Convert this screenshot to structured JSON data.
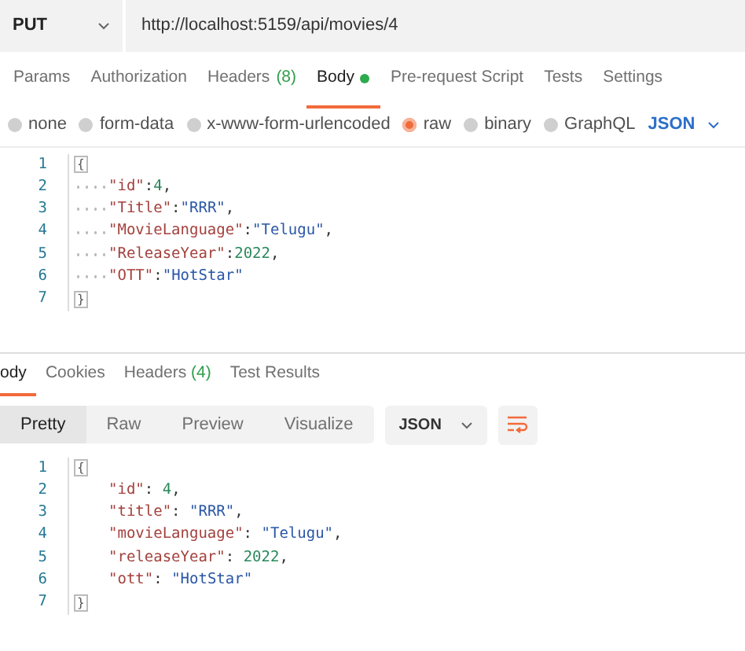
{
  "request": {
    "method": "PUT",
    "url": "http://localhost:5159/api/movies/4",
    "tabs": [
      {
        "label": "Params",
        "selected": false
      },
      {
        "label": "Authorization",
        "selected": false
      },
      {
        "label": "Headers",
        "count": "(8)",
        "selected": false
      },
      {
        "label": "Body",
        "has_content": true,
        "selected": true
      },
      {
        "label": "Pre-request Script",
        "selected": false
      },
      {
        "label": "Tests",
        "selected": false
      },
      {
        "label": "Settings",
        "selected": false
      }
    ],
    "body_types": [
      {
        "label": "none",
        "selected": false
      },
      {
        "label": "form-data",
        "selected": false
      },
      {
        "label": "x-www-form-urlencoded",
        "selected": false
      },
      {
        "label": "raw",
        "selected": true
      },
      {
        "label": "binary",
        "selected": false
      },
      {
        "label": "GraphQL",
        "selected": false
      }
    ],
    "format": "JSON",
    "editor": {
      "show_whitespace": true,
      "lines": [
        {
          "number": "1",
          "indented": false,
          "tokens": [
            {
              "kind": "brace",
              "text": "{"
            }
          ]
        },
        {
          "number": "2",
          "indented": true,
          "tokens": [
            {
              "kind": "key",
              "text": "\"id\""
            },
            {
              "kind": "punct",
              "text": ":"
            },
            {
              "kind": "number",
              "text": "4"
            },
            {
              "kind": "punct",
              "text": ","
            }
          ]
        },
        {
          "number": "3",
          "indented": true,
          "tokens": [
            {
              "kind": "key",
              "text": "\"Title\""
            },
            {
              "kind": "punct",
              "text": ":"
            },
            {
              "kind": "string",
              "text": "\"RRR\""
            },
            {
              "kind": "punct",
              "text": ","
            }
          ]
        },
        {
          "number": "4",
          "indented": true,
          "tokens": [
            {
              "kind": "key",
              "text": "\"MovieLanguage\""
            },
            {
              "kind": "punct",
              "text": ":"
            },
            {
              "kind": "string",
              "text": "\"Telugu\""
            },
            {
              "kind": "punct",
              "text": ","
            }
          ]
        },
        {
          "number": "5",
          "indented": true,
          "tokens": [
            {
              "kind": "key",
              "text": "\"ReleaseYear\""
            },
            {
              "kind": "punct",
              "text": ":"
            },
            {
              "kind": "number",
              "text": "2022"
            },
            {
              "kind": "punct",
              "text": ","
            }
          ]
        },
        {
          "number": "6",
          "indented": true,
          "tokens": [
            {
              "kind": "key",
              "text": "\"OTT\""
            },
            {
              "kind": "punct",
              "text": ":"
            },
            {
              "kind": "string",
              "text": "\"HotStar\""
            }
          ]
        },
        {
          "number": "7",
          "indented": false,
          "tokens": [
            {
              "kind": "brace",
              "text": "}"
            }
          ]
        }
      ]
    }
  },
  "response": {
    "tabs": [
      {
        "label": "ody",
        "selected": true
      },
      {
        "label": "Cookies",
        "selected": false
      },
      {
        "label": "Headers",
        "count": "(4)",
        "selected": false
      },
      {
        "label": "Test Results",
        "selected": false
      }
    ],
    "views": [
      {
        "label": "Pretty",
        "selected": true
      },
      {
        "label": "Raw",
        "selected": false
      },
      {
        "label": "Preview",
        "selected": false
      },
      {
        "label": "Visualize",
        "selected": false
      }
    ],
    "format": "JSON",
    "editor": {
      "show_whitespace": false,
      "lines": [
        {
          "number": "1",
          "indented": false,
          "tokens": [
            {
              "kind": "brace",
              "text": "{"
            }
          ]
        },
        {
          "number": "2",
          "indented": true,
          "tokens": [
            {
              "kind": "key",
              "text": "\"id\""
            },
            {
              "kind": "punct",
              "text": ": "
            },
            {
              "kind": "number",
              "text": "4"
            },
            {
              "kind": "punct",
              "text": ","
            }
          ]
        },
        {
          "number": "3",
          "indented": true,
          "tokens": [
            {
              "kind": "key",
              "text": "\"title\""
            },
            {
              "kind": "punct",
              "text": ": "
            },
            {
              "kind": "string",
              "text": "\"RRR\""
            },
            {
              "kind": "punct",
              "text": ","
            }
          ]
        },
        {
          "number": "4",
          "indented": true,
          "tokens": [
            {
              "kind": "key",
              "text": "\"movieLanguage\""
            },
            {
              "kind": "punct",
              "text": ": "
            },
            {
              "kind": "string",
              "text": "\"Telugu\""
            },
            {
              "kind": "punct",
              "text": ","
            }
          ]
        },
        {
          "number": "5",
          "indented": true,
          "tokens": [
            {
              "kind": "key",
              "text": "\"releaseYear\""
            },
            {
              "kind": "punct",
              "text": ": "
            },
            {
              "kind": "number",
              "text": "2022"
            },
            {
              "kind": "punct",
              "text": ","
            }
          ]
        },
        {
          "number": "6",
          "indented": true,
          "tokens": [
            {
              "kind": "key",
              "text": "\"ott\""
            },
            {
              "kind": "punct",
              "text": ": "
            },
            {
              "kind": "string",
              "text": "\"HotStar\""
            }
          ]
        },
        {
          "number": "7",
          "indented": false,
          "tokens": [
            {
              "kind": "brace",
              "text": "}"
            }
          ]
        }
      ]
    }
  }
}
